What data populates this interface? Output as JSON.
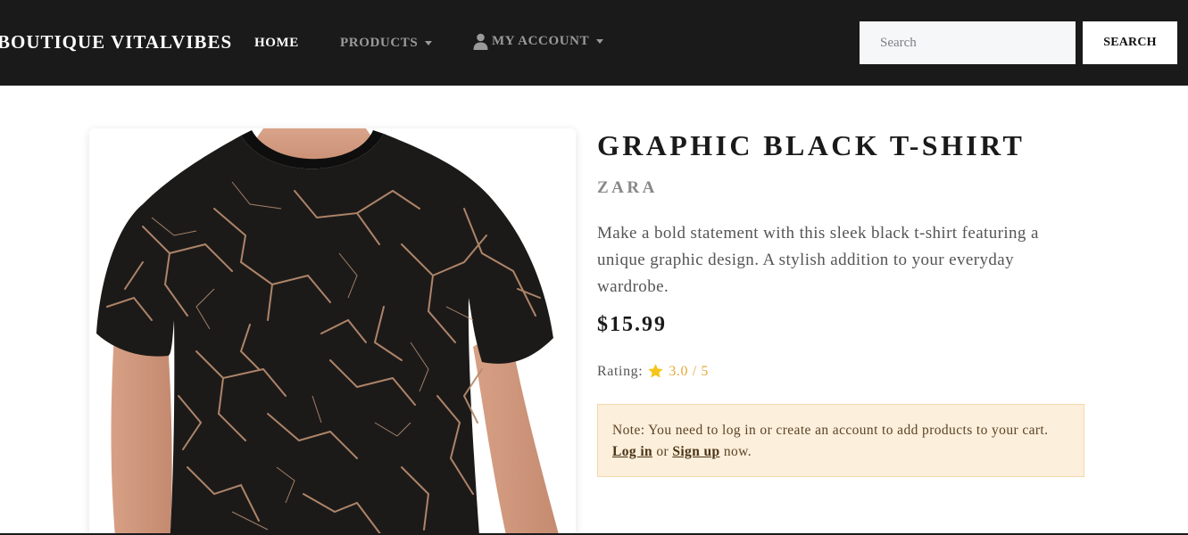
{
  "navbar": {
    "brand": "BOUTIQUE VITALVIBES",
    "links": [
      {
        "label": "HOME"
      },
      {
        "label": "PRODUCTS"
      },
      {
        "label": "MY ACCOUNT"
      }
    ],
    "search": {
      "placeholder": "Search",
      "value": "",
      "button_label": "SEARCH"
    }
  },
  "product": {
    "image_alt": "Graphic Black T-Shirt",
    "title": "GRAPHIC BLACK T-SHIRT",
    "brand": "ZARA",
    "description": "Make a bold statement with this sleek black t-shirt featuring a unique graphic design. A stylish addition to your everyday wardrobe.",
    "price": "$15.99",
    "rating_label": "Rating:",
    "rating_value": "3.0 / 5",
    "rating_color": "#e2a93a",
    "star_icon": "star-icon"
  },
  "note": {
    "prefix": "Note: You need to log in or create an account to add products to your cart.",
    "login_label": "Log in",
    "middle": "or",
    "signup_label": "Sign up",
    "suffix": "now."
  },
  "colors": {
    "navbar_bg": "#1a1a1a",
    "note_bg": "#fcefdc",
    "star": "#f5c518"
  }
}
